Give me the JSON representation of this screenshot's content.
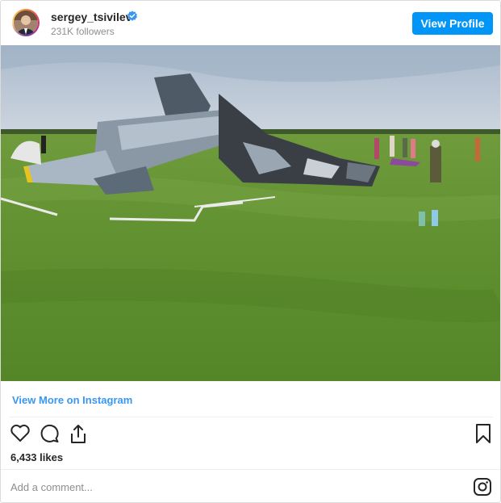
{
  "header": {
    "username": "sergey_tsivilev",
    "followers": "231K followers",
    "view_profile_label": "View Profile",
    "verified_icon": "verified-badge-icon",
    "accent_color": "#0095f6"
  },
  "post": {
    "image_icon": "photo",
    "view_more_label": "View More on Instagram",
    "likes": "6,433 likes",
    "actions": {
      "like_icon": "heart-icon",
      "comment_icon": "comment-icon",
      "share_icon": "share-icon",
      "save_icon": "bookmark-icon"
    }
  },
  "comment": {
    "placeholder": "Add a comment...",
    "instagram_icon": "instagram-icon"
  },
  "colors": {
    "link": "#3897f0",
    "muted": "#8e8e8e",
    "border": "#dbdbdb"
  }
}
